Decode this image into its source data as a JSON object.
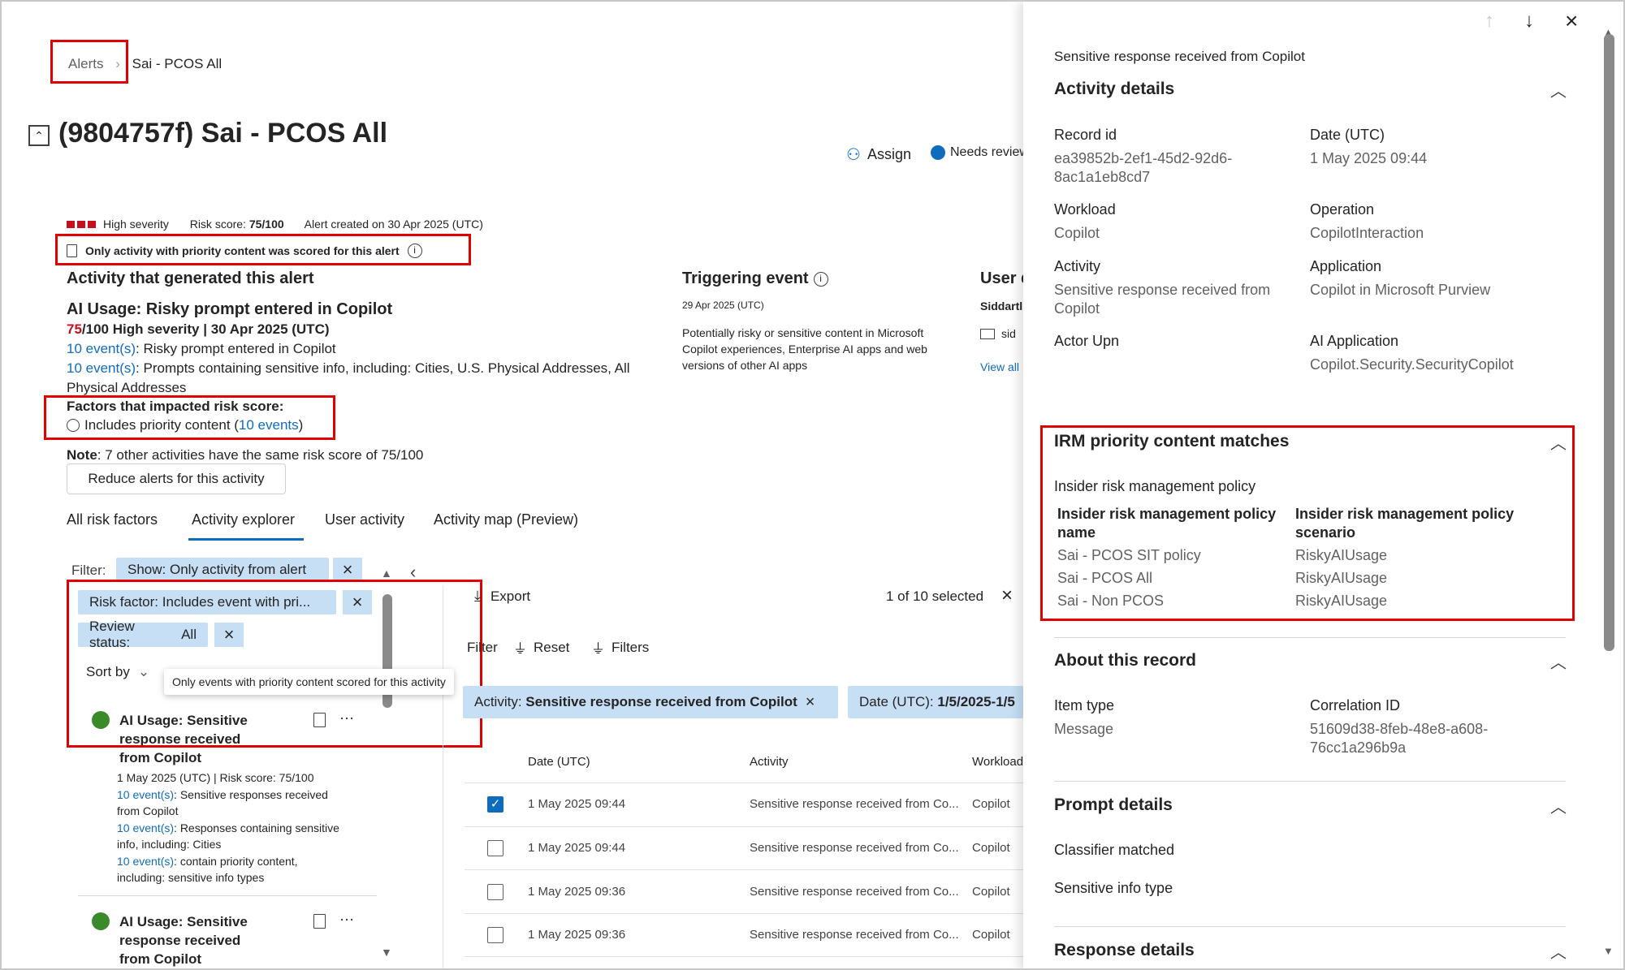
{
  "breadcrumb": {
    "root": "Alerts",
    "current": "Sai - PCOS All"
  },
  "page_title": "(9804757f) Sai - PCOS All",
  "actions": {
    "assign": "Assign",
    "status": "Needs review"
  },
  "alert_meta": {
    "severity": "High severity",
    "risk_label": "Risk score:",
    "risk_value": "75/100",
    "created": "Alert created on 30 Apr 2025 (UTC)",
    "priority_notice": "Only activity with priority content was scored for this alert"
  },
  "activity_section": {
    "heading": "Activity that generated this alert",
    "title": "AI Usage: Risky prompt entered in Copilot",
    "score_num": "75",
    "score_rest": "/100 High severity | 30 Apr 2025 (UTC)",
    "line1_link": "10 event(s)",
    "line1_text": ": Risky prompt entered in Copilot",
    "line2_link": "10 event(s)",
    "line2_text": ": Prompts containing sensitive info, including: Cities, U.S. Physical Addresses, All",
    "line2_cont": "Physical Addresses",
    "factors_heading": "Factors that impacted risk score:",
    "factor_text": "Includes priority content (",
    "factor_link": "10 events",
    "factor_close": ")",
    "note_label": "Note",
    "note_text": ": 7 other activities have the same risk score of 75/100",
    "reduce_button": "Reduce alerts for this activity"
  },
  "triggering": {
    "heading": "Triggering event",
    "date": "29 Apr 2025 (UTC)",
    "desc": "Potentially risky or sensitive content in Microsoft Copilot experiences, Enterprise AI apps and web versions of other AI apps"
  },
  "user_section": {
    "heading": "User d",
    "name": "Siddartl",
    "email": "sid",
    "view": "View all"
  },
  "tabs": [
    "All risk factors",
    "Activity explorer",
    "User activity",
    "Activity map (Preview)"
  ],
  "filters": {
    "label": "Filter:",
    "show_prefix": "Show: ",
    "show_value": "Only activity from alert",
    "risk_factor_prefix": "Risk factor: ",
    "risk_factor_value": "Includes event with pri...",
    "review_prefix": "Review status: ",
    "review_value": "All",
    "sort_by": "Sort by",
    "tooltip": "Only events with priority content scored for this activity"
  },
  "cards": [
    {
      "title_lines": [
        "AI Usage: Sensitive",
        "response received",
        "from Copilot"
      ],
      "meta": "1 May 2025 (UTC) | Risk score: 75/100",
      "l1_link": "10 event(s)",
      "l1_text": ": Sensitive responses received",
      "l1_cont": "from Copilot",
      "l2_link": "10 event(s)",
      "l2_text": ": Responses containing sensitive",
      "l2_cont": "info, including: Cities",
      "l3_link": "10 event(s)",
      "l3_text": ": contain priority content,",
      "l3_cont": "including: sensitive info types"
    },
    {
      "title_lines": [
        "AI Usage: Sensitive",
        "response received",
        "from Copilot"
      ]
    }
  ],
  "explorer": {
    "export": "Export",
    "selected": "1 of 10 selected",
    "filter": "Filter",
    "reset": "Reset",
    "filters": "Filters",
    "chip1_prefix": "Activity: ",
    "chip1_value": "Sensitive response received from Copilot",
    "chip2_prefix": "Date (UTC): ",
    "chip2_value": "1/5/2025-1/5",
    "columns": [
      "Date (UTC)",
      "Activity",
      "Workload"
    ],
    "rows": [
      {
        "date": "1 May 2025 09:44",
        "activity": "Sensitive response received from Co...",
        "workload": "Copilot",
        "checked": true
      },
      {
        "date": "1 May 2025 09:44",
        "activity": "Sensitive response received from Co...",
        "workload": "Copilot",
        "checked": false
      },
      {
        "date": "1 May 2025 09:36",
        "activity": "Sensitive response received from Co...",
        "workload": "Copilot",
        "checked": false
      },
      {
        "date": "1 May 2025 09:36",
        "activity": "Sensitive response received from Co...",
        "workload": "Copilot",
        "checked": false
      }
    ]
  },
  "panel": {
    "subtitle": "Sensitive response received from Copilot",
    "activity_details": "Activity details",
    "fields": {
      "record_id_label": "Record id",
      "record_id_1": "ea39852b-2ef1-45d2-92d6-",
      "record_id_2": "8ac1a1eb8cd7",
      "date_label": "Date (UTC)",
      "date": "1 May 2025 09:44",
      "workload_label": "Workload",
      "workload": "Copilot",
      "operation_label": "Operation",
      "operation": "CopilotInteraction",
      "activity_label": "Activity",
      "activity_1": "Sensitive response received from",
      "activity_2": "Copilot",
      "application_label": "Application",
      "application": "Copilot in Microsoft Purview",
      "actor_label": "Actor Upn",
      "ai_app_label": "AI Application",
      "ai_app": "Copilot.Security.SecurityCopilot"
    },
    "irm": {
      "heading": "IRM priority content matches",
      "policy_heading": "Insider risk management policy",
      "col1": [
        "Insider risk management policy",
        "name"
      ],
      "col2": [
        "Insider risk management policy",
        "scenario"
      ],
      "rows": [
        {
          "name": "Sai - PCOS SIT policy",
          "scenario": "RiskyAIUsage"
        },
        {
          "name": "Sai - PCOS All",
          "scenario": "RiskyAIUsage"
        },
        {
          "name": "Sai - Non PCOS",
          "scenario": "RiskyAIUsage"
        }
      ]
    },
    "about": {
      "heading": "About this record",
      "item_type_label": "Item type",
      "item_type": "Message",
      "corr_label": "Correlation ID",
      "corr_1": "51609d38-8feb-48e8-a608-",
      "corr_2": "76cc1a296b9a"
    },
    "prompt": {
      "heading": "Prompt details",
      "classifier": "Classifier matched",
      "sit": "Sensitive info type"
    },
    "response": {
      "heading": "Response details"
    }
  },
  "colors": {
    "accent": "#0f6cbd",
    "severity": "#c50f1f",
    "highlight": "#e00000",
    "chip": "#c7dff5",
    "success": "#3a8a2a"
  }
}
